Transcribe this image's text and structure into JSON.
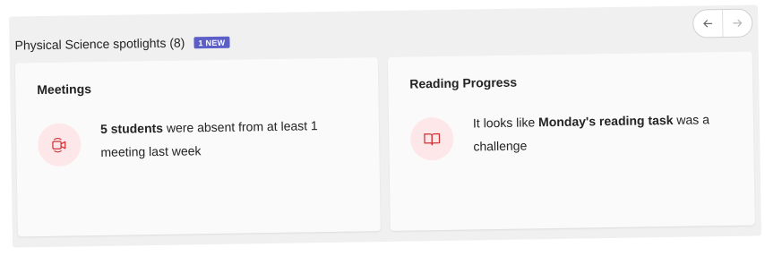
{
  "header": {
    "title": "Physical Science spotlights (8)",
    "badge": "1 NEW",
    "prev_icon": "arrow-left-icon",
    "next_icon": "arrow-right-icon"
  },
  "cards": [
    {
      "title": "Meetings",
      "icon": "video-call-icon",
      "text_bold": "5 students",
      "text_rest": " were absent from at least 1 meeting last week"
    },
    {
      "title": "Reading Progress",
      "icon": "book-icon",
      "text_pre": "It looks like ",
      "text_bold": "Monday's reading task",
      "text_post": " was a challenge"
    }
  ],
  "colors": {
    "badge": "#5b5fc7",
    "icon_bg": "#fde7e9",
    "icon_stroke": "#d13438"
  }
}
